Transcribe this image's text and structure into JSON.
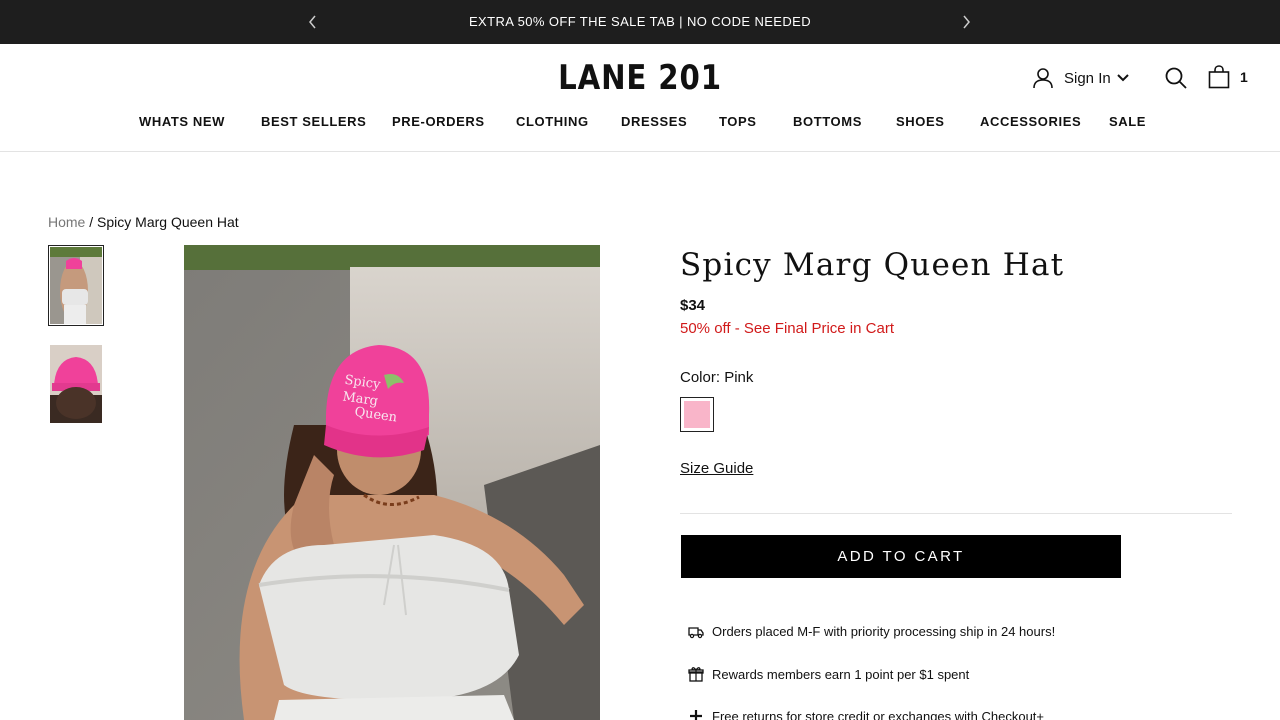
{
  "announcement": {
    "message": "EXTRA 50% OFF THE SALE TAB | NO CODE NEEDED"
  },
  "header": {
    "logo": "LANE 201",
    "sign_in": "Sign In",
    "cart_count": "1"
  },
  "nav": {
    "items": [
      "WHATS NEW",
      "BEST SELLERS",
      "PRE-ORDERS",
      "CLOTHING",
      "DRESSES",
      "TOPS",
      "BOTTOMS",
      "SHOES",
      "ACCESSORIES",
      "SALE"
    ]
  },
  "breadcrumb": {
    "home": "Home",
    "separator": "/",
    "current": "Spicy Marg Queen Hat"
  },
  "product": {
    "title": "Spicy Marg Queen Hat",
    "price": "$34",
    "promo": "50% off - See Final Price in Cart",
    "color_label": "Color:",
    "color_value": "Pink",
    "swatch_color": "#f9b5c9",
    "size_guide": "Size Guide",
    "add_to_cart": "ADD TO CART"
  },
  "perks": [
    {
      "icon": "delivery-truck-icon",
      "text": "Orders placed M-F with priority processing ship in 24 hours!"
    },
    {
      "icon": "gift-icon",
      "text": "Rewards members earn 1 point per $1 spent"
    },
    {
      "icon": "plus-icon",
      "text": "Free returns for store credit or exchanges with Checkout+"
    }
  ],
  "colors": {
    "announcement_bg": "#1e1e1e",
    "promo": "#d11a1a",
    "hat_pink": "#f0419a",
    "button_bg": "#000000"
  }
}
